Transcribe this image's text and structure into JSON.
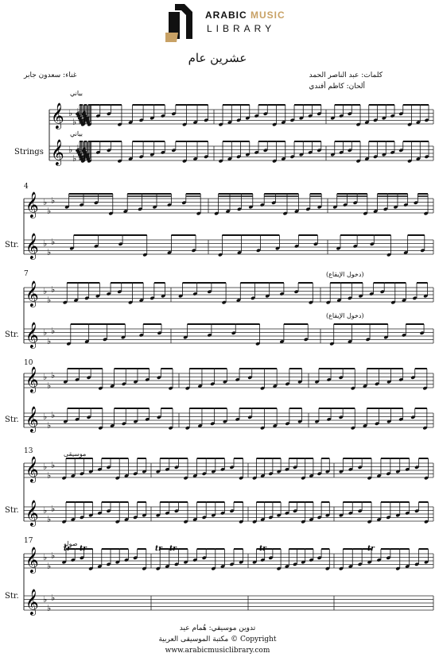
{
  "header": {
    "logo_line1_a": "ARABIC ",
    "logo_line1_b": "MUSIC",
    "logo_line2": "LIBRARY",
    "accent_color": "#c8a165"
  },
  "song": {
    "title": "عشرين عام",
    "lyrics": "كلمات: عبد الناصر الحمد",
    "composer": "ألحان: كاظم أفندي",
    "singer": "غناء: سعدون جابر"
  },
  "score": {
    "instrument_full": "Strings",
    "instrument_short": "Str.",
    "key_signature": "E-flat major (3 flats)",
    "time_signature": "4/4",
    "annotations": {
      "piano_top": "بياني",
      "piano_bottom": "بياني",
      "rhythm_in_1": "(دخول الإيقاع)",
      "rhythm_in_2": "(دخول الإيقاع)",
      "music": "موسيقى",
      "solo": "صولو",
      "trill": "tr"
    },
    "measure_numbers": [
      "4",
      "7",
      "10",
      "13",
      "17"
    ]
  },
  "footer": {
    "notation": "تدوين موسيقي: هُمام عيد",
    "copyright": "مكتبة الموسيقى العربية © Copyright",
    "website": "www.arabicmusiclibrary.com"
  }
}
